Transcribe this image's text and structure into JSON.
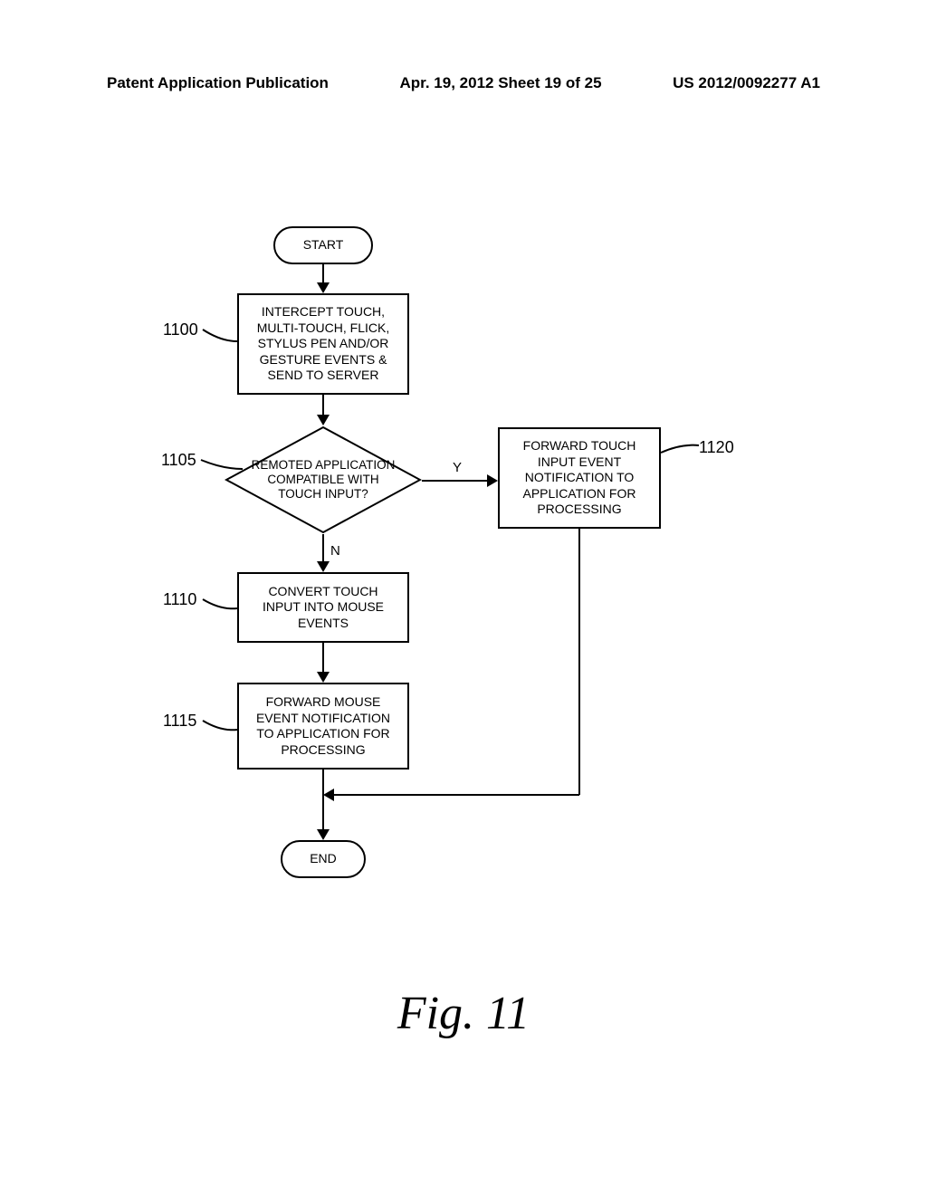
{
  "header": {
    "left": "Patent Application Publication",
    "mid": "Apr. 19, 2012  Sheet 19 of 25",
    "right": "US 2012/0092277 A1"
  },
  "labels": {
    "n1100": "1100",
    "n1105": "1105",
    "n1110": "1110",
    "n1115": "1115",
    "n1120": "1120"
  },
  "nodes": {
    "start": "START",
    "intercept": "INTERCEPT TOUCH, MULTI-TOUCH, FLICK, STYLUS PEN AND/OR GESTURE EVENTS & SEND TO SERVER",
    "decision": "REMOTED APPLICATION COMPATIBLE WITH TOUCH INPUT?",
    "convert": "CONVERT TOUCH INPUT INTO MOUSE EVENTS",
    "fwd_mouse": "FORWARD MOUSE EVENT NOTIFICATION TO APPLICATION FOR PROCESSING",
    "fwd_touch": "FORWARD TOUCH INPUT EVENT NOTIFICATION TO APPLICATION FOR PROCESSING",
    "end": "END"
  },
  "flowlabels": {
    "yes": "Y",
    "no": "N"
  },
  "figure_caption": "Fig. 11"
}
